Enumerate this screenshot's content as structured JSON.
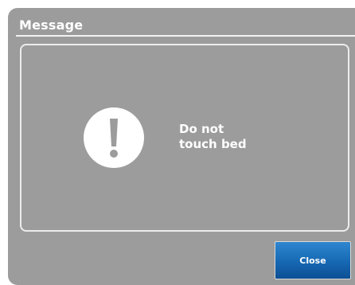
{
  "dialog": {
    "title": "Message",
    "message": "Do not\ntouch bed",
    "icon": "exclamation-icon",
    "close_label": "Close"
  },
  "colors": {
    "dialog_background": "#9c9c9c",
    "text": "#ffffff",
    "button": "#1668b3"
  }
}
